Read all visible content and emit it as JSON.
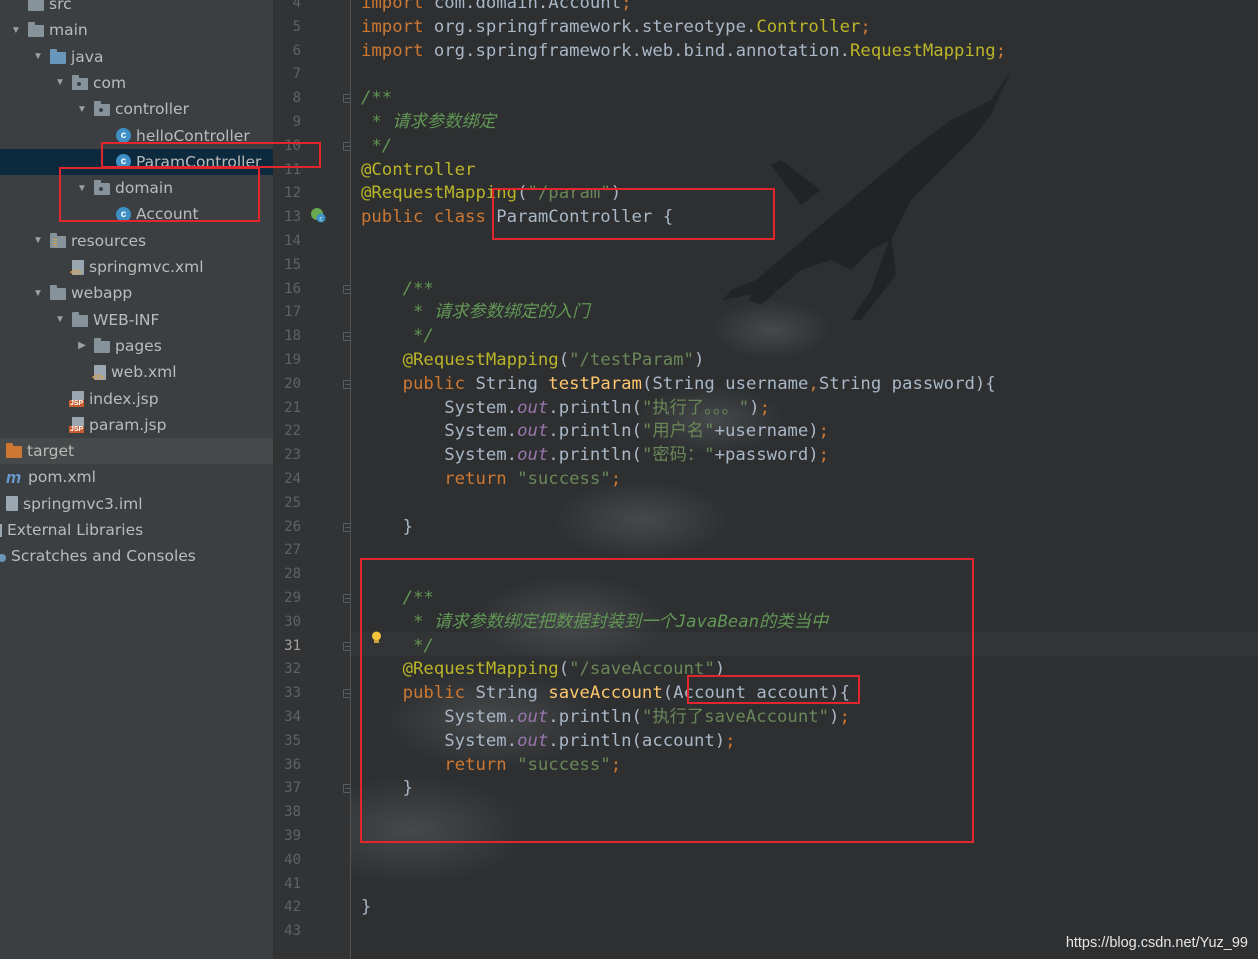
{
  "tree": {
    "items": [
      {
        "label": "src",
        "depth": 0,
        "arrow": "",
        "icon": "folder-icon"
      },
      {
        "label": "main",
        "depth": 0,
        "arrow": "down",
        "icon": "folder-icon"
      },
      {
        "label": "java",
        "depth": 1,
        "arrow": "down",
        "icon": "source-folder-icon"
      },
      {
        "label": "com",
        "depth": 2,
        "arrow": "down",
        "icon": "package-icon"
      },
      {
        "label": "controller",
        "depth": 3,
        "arrow": "down",
        "icon": "package-icon"
      },
      {
        "label": "helloController",
        "depth": 4,
        "arrow": "",
        "icon": "class-icon"
      },
      {
        "label": "ParamController",
        "depth": 4,
        "arrow": "",
        "icon": "class-icon",
        "selected": true
      },
      {
        "label": "domain",
        "depth": 3,
        "arrow": "down",
        "icon": "package-icon"
      },
      {
        "label": "Account",
        "depth": 4,
        "arrow": "",
        "icon": "class-icon"
      },
      {
        "label": "resources",
        "depth": 1,
        "arrow": "down",
        "icon": "resources-folder-icon"
      },
      {
        "label": "springmvc.xml",
        "depth": 2,
        "arrow": "",
        "icon": "xml-file-icon"
      },
      {
        "label": "webapp",
        "depth": 1,
        "arrow": "down",
        "icon": "folder-icon"
      },
      {
        "label": "WEB-INF",
        "depth": 2,
        "arrow": "down",
        "icon": "folder-icon"
      },
      {
        "label": "pages",
        "depth": 3,
        "arrow": "right",
        "icon": "folder-icon"
      },
      {
        "label": "web.xml",
        "depth": 3,
        "arrow": "",
        "icon": "xml-file-icon"
      },
      {
        "label": "index.jsp",
        "depth": 2,
        "arrow": "",
        "icon": "jsp-file-icon"
      },
      {
        "label": "param.jsp",
        "depth": 2,
        "arrow": "",
        "icon": "jsp-file-icon"
      },
      {
        "label": "target",
        "depth": -1,
        "arrow": "",
        "icon": "target-folder-icon",
        "highlight": true
      },
      {
        "label": "pom.xml",
        "depth": -1,
        "arrow": "",
        "icon": "maven-icon"
      },
      {
        "label": "springmvc3.iml",
        "depth": -1,
        "arrow": "",
        "icon": "module-file-icon"
      },
      {
        "label": "External Libraries",
        "depth": -2,
        "arrow": "",
        "icon": "library-icon"
      },
      {
        "label": "Scratches and Consoles",
        "depth": -2,
        "arrow": "",
        "icon": "scratches-icon"
      }
    ]
  },
  "editor": {
    "line_numbers": [
      "4",
      "5",
      "6",
      "7",
      "8",
      "9",
      "10",
      "11",
      "12",
      "13",
      "14",
      "15",
      "16",
      "17",
      "18",
      "19",
      "20",
      "21",
      "22",
      "23",
      "24",
      "25",
      "26",
      "27",
      "28",
      "29",
      "30",
      "31",
      "32",
      "33",
      "34",
      "35",
      "36",
      "37",
      "38",
      "39",
      "40",
      "41",
      "42",
      "43"
    ],
    "current_line": "31",
    "lines": [
      [
        [
          "kw",
          "import "
        ],
        [
          "plain",
          "com.domain.Account"
        ],
        [
          "kw",
          ";"
        ]
      ],
      [
        [
          "kw",
          "import "
        ],
        [
          "plain",
          "org.springframework.stereotype."
        ],
        [
          "ann",
          "Controller"
        ],
        [
          "kw",
          ";"
        ]
      ],
      [
        [
          "kw",
          "import "
        ],
        [
          "plain",
          "org.springframework.web.bind.annotation."
        ],
        [
          "ann",
          "RequestMapping"
        ],
        [
          "kw",
          ";"
        ]
      ],
      [],
      [
        [
          "com",
          "/**"
        ]
      ],
      [
        [
          "com",
          " * 请求参数绑定"
        ]
      ],
      [
        [
          "com",
          " */"
        ]
      ],
      [
        [
          "ann",
          "@Controller"
        ]
      ],
      [
        [
          "ann",
          "@RequestMapping"
        ],
        [
          "plain",
          "("
        ],
        [
          "str",
          "\"/param\""
        ],
        [
          "plain",
          ")"
        ]
      ],
      [
        [
          "kw",
          "public class "
        ],
        [
          "plain",
          "ParamController {"
        ]
      ],
      [],
      [],
      [
        [
          "com",
          "    /**"
        ]
      ],
      [
        [
          "com",
          "     * 请求参数绑定的入门"
        ]
      ],
      [
        [
          "com",
          "     */"
        ]
      ],
      [
        [
          "ann",
          "    @RequestMapping"
        ],
        [
          "plain",
          "("
        ],
        [
          "str",
          "\"/testParam\""
        ],
        [
          "plain",
          ")"
        ]
      ],
      [
        [
          "kw",
          "    public "
        ],
        [
          "plain",
          "String "
        ],
        [
          "fn",
          "testParam"
        ],
        [
          "plain",
          "(String username"
        ],
        [
          "kw",
          ","
        ],
        [
          "plain",
          "String password){"
        ]
      ],
      [
        [
          "plain",
          "        System."
        ],
        [
          "fld",
          "out"
        ],
        [
          "plain",
          ".println("
        ],
        [
          "str",
          "\"执行了。。。\""
        ],
        [
          "plain",
          ")"
        ],
        [
          "kw",
          ";"
        ]
      ],
      [
        [
          "plain",
          "        System."
        ],
        [
          "fld",
          "out"
        ],
        [
          "plain",
          ".println("
        ],
        [
          "str",
          "\"用户名\""
        ],
        [
          "plain",
          "+username)"
        ],
        [
          "kw",
          ";"
        ]
      ],
      [
        [
          "plain",
          "        System."
        ],
        [
          "fld",
          "out"
        ],
        [
          "plain",
          ".println("
        ],
        [
          "str",
          "\"密码：\""
        ],
        [
          "plain",
          "+password)"
        ],
        [
          "kw",
          ";"
        ]
      ],
      [
        [
          "kw",
          "        return "
        ],
        [
          "str",
          "\"success\""
        ],
        [
          "kw",
          ";"
        ]
      ],
      [],
      [
        [
          "plain",
          "    }"
        ]
      ],
      [],
      [],
      [
        [
          "com",
          "    /**"
        ]
      ],
      [
        [
          "com",
          "     * 请求参数绑定把数据封装到一个JavaBean的类当中"
        ]
      ],
      [
        [
          "com",
          "     */"
        ]
      ],
      [
        [
          "ann",
          "    @RequestMapping"
        ],
        [
          "plain",
          "("
        ],
        [
          "str",
          "\"/saveAccount\""
        ],
        [
          "plain",
          ")"
        ]
      ],
      [
        [
          "kw",
          "    public "
        ],
        [
          "plain",
          "String "
        ],
        [
          "fn",
          "saveAccount"
        ],
        [
          "plain",
          "(Account account){"
        ]
      ],
      [
        [
          "plain",
          "        System."
        ],
        [
          "fld",
          "out"
        ],
        [
          "plain",
          ".println("
        ],
        [
          "str",
          "\"执行了saveAccount\""
        ],
        [
          "plain",
          ")"
        ],
        [
          "kw",
          ";"
        ]
      ],
      [
        [
          "plain",
          "        System."
        ],
        [
          "fld",
          "out"
        ],
        [
          "plain",
          ".println(account)"
        ],
        [
          "kw",
          ";"
        ]
      ],
      [
        [
          "kw",
          "        return "
        ],
        [
          "str",
          "\"success\""
        ],
        [
          "kw",
          ";"
        ]
      ],
      [
        [
          "plain",
          "    }"
        ]
      ],
      [],
      [],
      [],
      [],
      [
        [
          "plain",
          "}"
        ]
      ],
      []
    ]
  },
  "watermark": "https://blog.csdn.net/Yuz_99",
  "colors": {
    "keyword": "#cc7832",
    "annotation": "#bbb529",
    "string": "#6a8759",
    "comment": "#629755",
    "highlight_box": "#e2262e"
  }
}
